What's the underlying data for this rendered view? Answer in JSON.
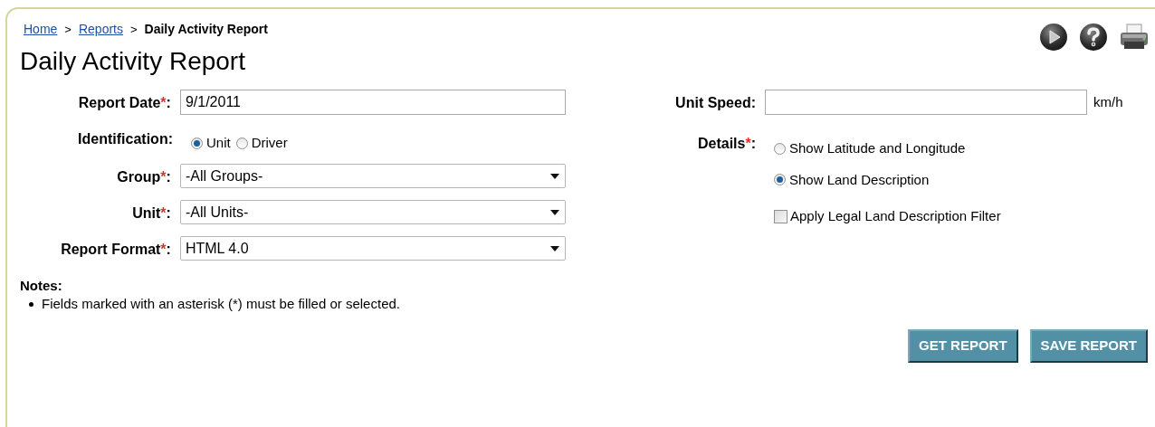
{
  "breadcrumb": [
    {
      "kind": "link",
      "label": "Home"
    },
    {
      "kind": "separator",
      "label": ">"
    },
    {
      "kind": "link",
      "label": "Reports"
    },
    {
      "kind": "separator",
      "label": ">"
    },
    {
      "kind": "current",
      "label": "Daily Activity Report"
    }
  ],
  "title": "Daily Activity Report",
  "left_fields": [
    {
      "kind": "text",
      "label": "Report Date",
      "required_mark": "*",
      "label_end": ":",
      "value": "9/1/2011"
    },
    {
      "kind": "radio",
      "label": "Identification",
      "label_end": ":",
      "options": [
        {
          "label": "Unit",
          "selected": true
        },
        {
          "label": "Driver",
          "selected": false
        }
      ]
    },
    {
      "kind": "select",
      "label": "Group",
      "required_mark": "*",
      "label_end": ":",
      "value": "-All Groups-"
    },
    {
      "kind": "select",
      "label": "Unit",
      "required_mark": "*",
      "label_end": ":",
      "value": "-All Units-"
    },
    {
      "kind": "select",
      "label": "Report Format",
      "required_mark": "*",
      "label_end": ":",
      "value": "HTML 4.0"
    }
  ],
  "right_fields": [
    {
      "kind": "text",
      "label": "Unit Speed",
      "label_end": ":",
      "unit": "km/h"
    },
    {
      "kind": "options",
      "label": "Details",
      "required_mark": "*",
      "label_end": ":",
      "options": [
        {
          "kind": "radio",
          "label": "Show Latitude and Longitude",
          "selected": false
        },
        {
          "kind": "radio",
          "label": "Show Land Description",
          "selected": true
        },
        {
          "kind": "checkbox",
          "label": "Apply Legal Land Description Filter",
          "checked": false
        }
      ]
    }
  ],
  "notes": {
    "heading": "Notes:",
    "items": [
      "Fields marked with an asterisk (*) must be filled or selected."
    ]
  },
  "buttons": [
    "GET REPORT",
    "SAVE REPORT"
  ]
}
